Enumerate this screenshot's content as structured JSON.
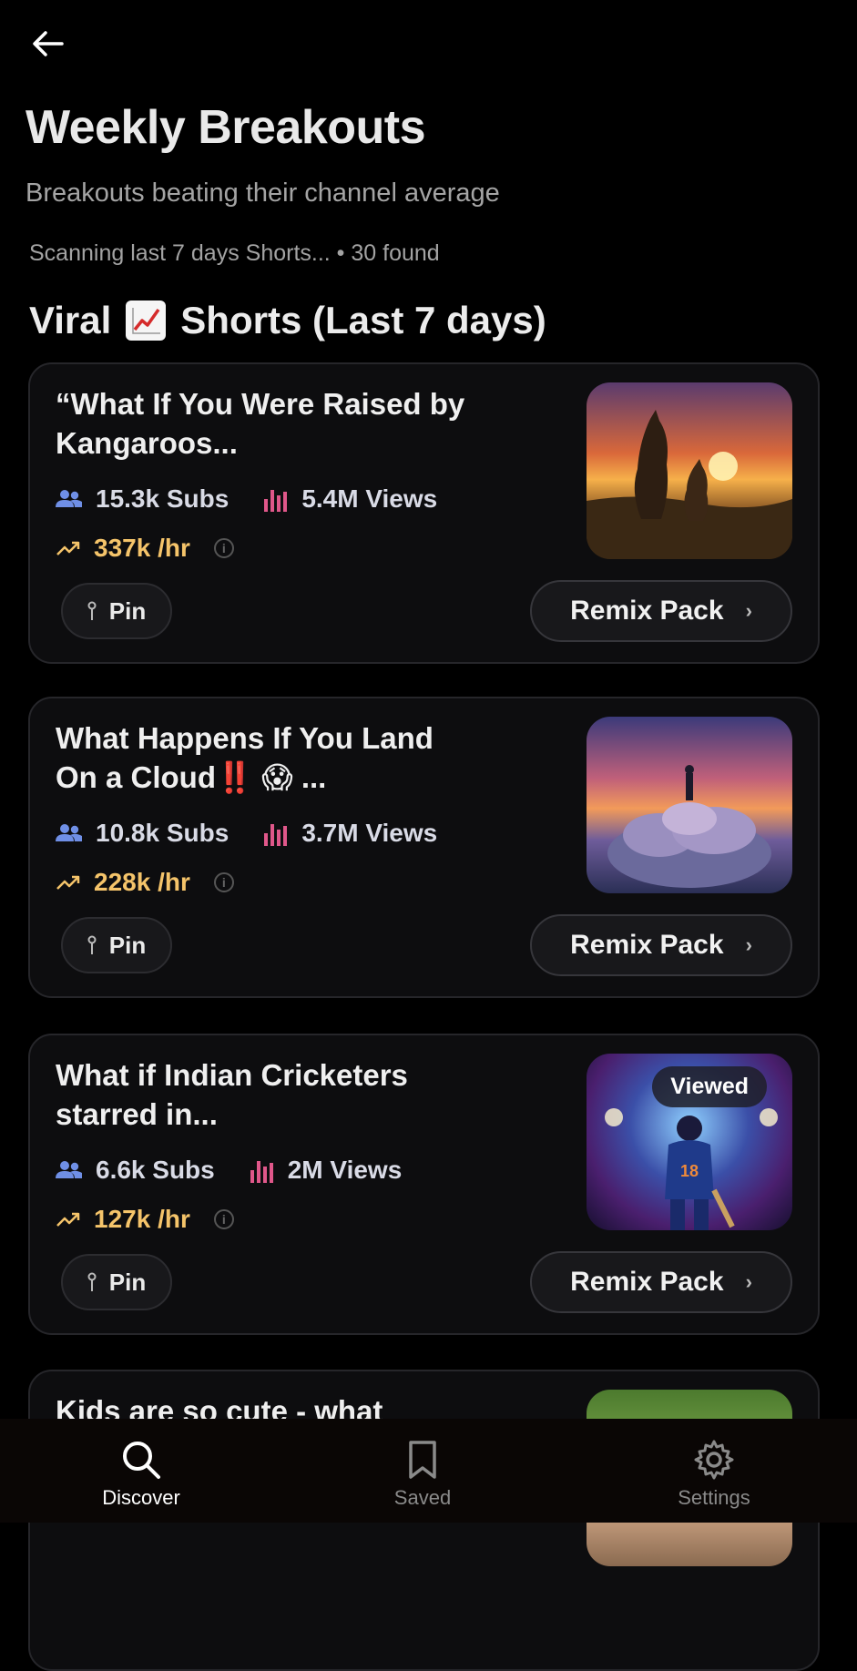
{
  "header": {
    "back_icon": "arrow-left-icon",
    "title": "Weekly Breakouts",
    "subtitle": "Breakouts beating their channel average",
    "status": "Scanning last 7 days Shorts... • 30 found"
  },
  "section": {
    "title_prefix": "Viral",
    "title_icon": "chart-increasing-emoji",
    "title_suffix": "Shorts (Last 7 days)"
  },
  "cards": [
    {
      "title": "“What If You Were Raised by Kangaroos...",
      "subs": "15.3k Subs",
      "views": "5.4M Views",
      "rate": "337k /hr",
      "pin_label": "Pin",
      "remix_label": "Remix Pack",
      "thumbnail": "kangaroos-sunset-image",
      "badge": ""
    },
    {
      "title": "What Happens If You Land On a Cloud‼️ 😱 ...",
      "subs": "10.8k Subs",
      "views": "3.7M Views",
      "rate": "228k /hr",
      "pin_label": "Pin",
      "remix_label": "Remix Pack",
      "thumbnail": "person-on-cloud-image",
      "badge": ""
    },
    {
      "title": "What if Indian Cricketers starred in...",
      "subs": "6.6k Subs",
      "views": "2M Views",
      "rate": "127k /hr",
      "pin_label": "Pin",
      "remix_label": "Remix Pack",
      "thumbnail": "cricketer-stadium-image",
      "badge": "Viewed"
    },
    {
      "title": "Kids are so cute - what",
      "thumbnail": "kids-outdoor-image"
    }
  ],
  "nav": {
    "discover": "Discover",
    "saved": "Saved",
    "settings": "Settings"
  },
  "colors": {
    "background": "#000000",
    "card": "#0d0d0f",
    "rate": "#f5c46a",
    "subs_icon": "#6f8fe6",
    "views_icon": "#e0578a",
    "nav_active": "#ffffff",
    "nav_inactive": "#8a8a8a"
  }
}
